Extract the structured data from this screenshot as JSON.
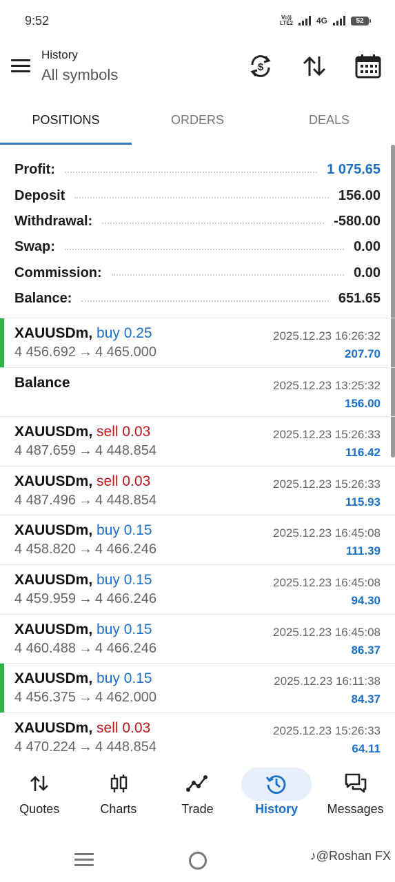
{
  "status_bar": {
    "time": "9:52",
    "volte_line1": "Vo))",
    "volte_line2": "LTE2",
    "network": "4G",
    "battery": "52"
  },
  "header": {
    "title": "History",
    "subtitle": "All symbols",
    "icons": [
      "menu-icon",
      "currency-exchange-icon",
      "sort-icon",
      "calendar-icon"
    ]
  },
  "tabs": [
    {
      "label": "POSITIONS",
      "active": true
    },
    {
      "label": "ORDERS",
      "active": false
    },
    {
      "label": "DEALS",
      "active": false
    }
  ],
  "summary": [
    {
      "label": "Profit:",
      "value": "1 075.65",
      "style": "blue"
    },
    {
      "label": "Deposit",
      "value": "156.00",
      "style": "dark"
    },
    {
      "label": "Withdrawal:",
      "value": "-580.00",
      "style": "dark"
    },
    {
      "label": "Swap:",
      "value": "0.00",
      "style": "dark"
    },
    {
      "label": "Commission:",
      "value": "0.00",
      "style": "dark"
    },
    {
      "label": "Balance:",
      "value": "651.65",
      "style": "dark"
    }
  ],
  "deals": [
    {
      "symbol": "XAUUSDm,",
      "side": "buy",
      "side_text": "buy 0.25",
      "open": "4 456.692",
      "close": "4 465.000",
      "time": "2025.12.23 16:26:32",
      "profit": "207.70",
      "highlight": true
    },
    {
      "symbol": "Balance",
      "side": "",
      "side_text": "",
      "open": "",
      "close": "",
      "time": "2025.12.23 13:25:32",
      "profit": "156.00",
      "highlight": false
    },
    {
      "symbol": "XAUUSDm,",
      "side": "sell",
      "side_text": "sell 0.03",
      "open": "4 487.659",
      "close": "4 448.854",
      "time": "2025.12.23 15:26:33",
      "profit": "116.42",
      "highlight": false
    },
    {
      "symbol": "XAUUSDm,",
      "side": "sell",
      "side_text": "sell 0.03",
      "open": "4 487.496",
      "close": "4 448.854",
      "time": "2025.12.23 15:26:33",
      "profit": "115.93",
      "highlight": false
    },
    {
      "symbol": "XAUUSDm,",
      "side": "buy",
      "side_text": "buy 0.15",
      "open": "4 458.820",
      "close": "4 466.246",
      "time": "2025.12.23 16:45:08",
      "profit": "111.39",
      "highlight": false
    },
    {
      "symbol": "XAUUSDm,",
      "side": "buy",
      "side_text": "buy 0.15",
      "open": "4 459.959",
      "close": "4 466.246",
      "time": "2025.12.23 16:45:08",
      "profit": "94.30",
      "highlight": false
    },
    {
      "symbol": "XAUUSDm,",
      "side": "buy",
      "side_text": "buy 0.15",
      "open": "4 460.488",
      "close": "4 466.246",
      "time": "2025.12.23 16:45:08",
      "profit": "86.37",
      "highlight": false
    },
    {
      "symbol": "XAUUSDm,",
      "side": "buy",
      "side_text": "buy 0.15",
      "open": "4 456.375",
      "close": "4 462.000",
      "time": "2025.12.23 16:11:38",
      "profit": "84.37",
      "highlight": true
    },
    {
      "symbol": "XAUUSDm,",
      "side": "sell",
      "side_text": "sell 0.03",
      "open": "4 470.224",
      "close": "4 448.854",
      "time": "2025.12.23 15:26:33",
      "profit": "64.11",
      "highlight": false
    }
  ],
  "bottom_nav": [
    {
      "label": "Quotes",
      "icon": "quotes-arrows-icon",
      "active": false
    },
    {
      "label": "Charts",
      "icon": "candlestick-icon",
      "active": false
    },
    {
      "label": "Trade",
      "icon": "trend-line-icon",
      "active": false
    },
    {
      "label": "History",
      "icon": "history-clock-icon",
      "active": true
    },
    {
      "label": "Messages",
      "icon": "chat-bubbles-icon",
      "active": false
    }
  ],
  "watermark": "@Roshan FX",
  "colors": {
    "accent_blue": "#1b6fc6",
    "sell_red": "#c0141b",
    "highlight_green": "#2fb24a",
    "tab_underline": "#3a7bc8"
  }
}
